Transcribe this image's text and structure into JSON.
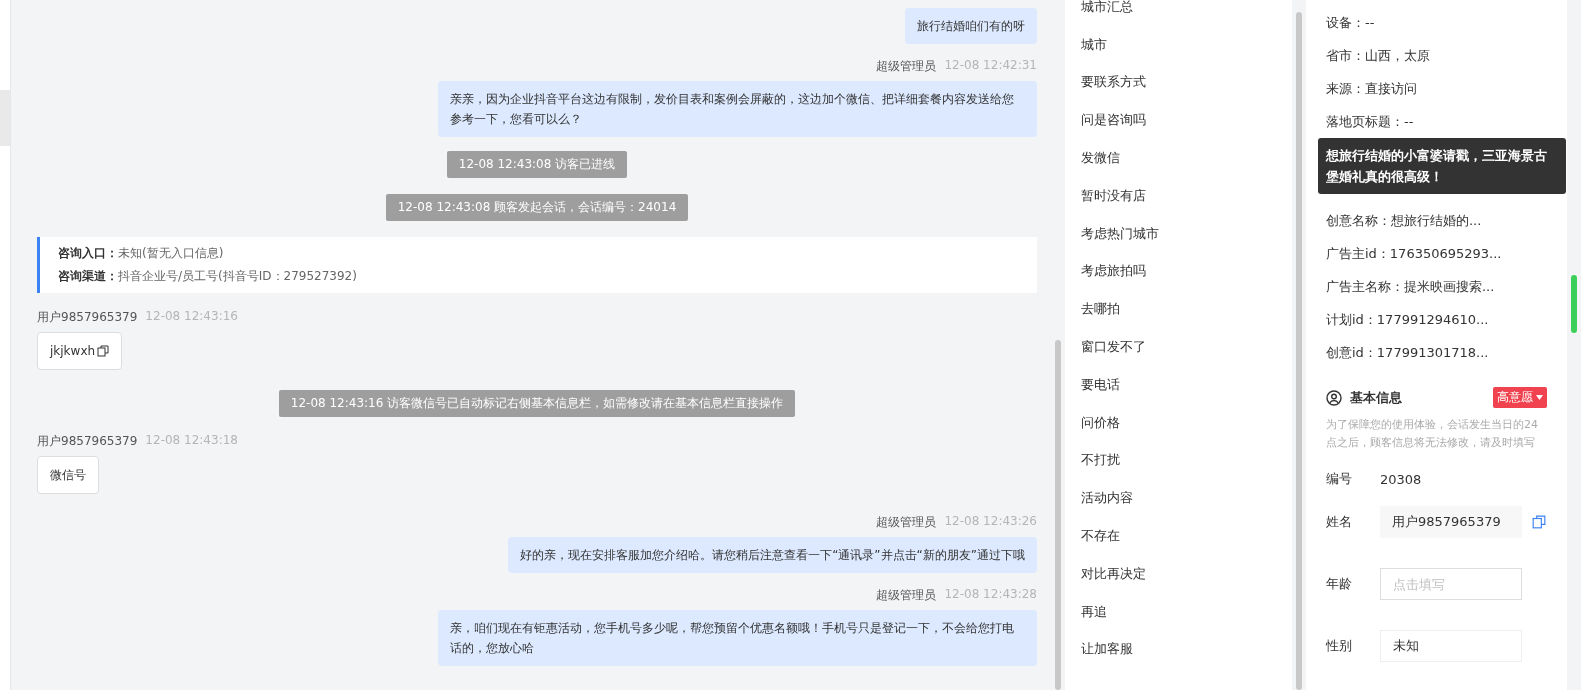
{
  "chat": {
    "messages": [
      {
        "kind": "agent",
        "text": "旅行结婚咱们有的呀"
      },
      {
        "kind": "agent",
        "sender": "超级管理员",
        "time": "12-08 12:42:31",
        "text": "亲亲，因为企业抖音平台这边有限制，发价目表和案例会屏蔽的，这边加个微信、把详细套餐内容发送给您参考一下，您看可以么？"
      },
      {
        "kind": "system",
        "text": "12-08 12:43:08 访客已进线"
      },
      {
        "kind": "system",
        "text": "12-08 12:43:08 顾客发起会话，会话编号：24014"
      },
      {
        "kind": "info",
        "entries": [
          {
            "label": "咨询入口：",
            "value": "未知(暂无入口信息)"
          },
          {
            "label": "咨询渠道：",
            "value": "抖音企业号/员工号(抖音号ID：279527392)"
          }
        ]
      },
      {
        "kind": "visitor",
        "sender": "用户9857965379",
        "time": "12-08 12:43:16",
        "text": "jkjkwxh",
        "copyable": true
      },
      {
        "kind": "system",
        "text": "12-08 12:43:16 访客微信号已自动标记右侧基本信息栏，如需修改请在基本信息栏直接操作"
      },
      {
        "kind": "visitor",
        "sender": "用户9857965379",
        "time": "12-08 12:43:18",
        "text": "微信号",
        "copyable": false
      },
      {
        "kind": "agent",
        "sender": "超级管理员",
        "time": "12-08 12:43:26",
        "text": "好的亲，现在安排客服加您介绍哈。请您稍后注意查看一下“通讯录”并点击“新的朋友”通过下哦"
      },
      {
        "kind": "agent",
        "sender": "超级管理员",
        "time": "12-08 12:43:28",
        "text": "亲，咱们现在有钜惠活动，您手机号多少呢，帮您预留个优惠名额哦！手机号只是登记一下，不会给您打电话的，您放心哈"
      }
    ]
  },
  "quick_replies": [
    "城市汇总",
    "城市",
    "要联系方式",
    "问是咨询吗",
    "发微信",
    "暂时没有店",
    "考虑热门城市",
    "考虑旅拍吗",
    "去哪拍",
    "窗口发不了",
    "要电话",
    "问价格",
    "不打扰",
    "活动内容",
    "不存在",
    "对比再决定",
    "再追",
    "让加客服"
  ],
  "visit_info": {
    "rows_above": [
      "设备：--",
      "省市：山西，太原",
      "来源：直接访问",
      "落地页标题：--"
    ],
    "tooltip": "想旅行结婚的小富婆请戳，三亚海景古堡婚礼真的很高级！",
    "rows_below": [
      "创意名称：想旅行结婚的...",
      "广告主id：176350695293...",
      "广告主名称：提米映画搜索...",
      "计划id：177991294610...",
      "创意id：177991301718..."
    ]
  },
  "basic_info": {
    "title": "基本信息",
    "intent_tag": "高意愿",
    "notice": "为了保障您的使用体验，会话发生当日的24点之后，顾客信息将无法修改，请及时填写",
    "fields": [
      {
        "kind": "text",
        "label": "编号",
        "value": "20308"
      },
      {
        "kind": "copy",
        "label": "姓名",
        "value": "用户9857965379"
      },
      {
        "kind": "input",
        "label": "年龄",
        "placeholder": "点击填写"
      },
      {
        "kind": "select",
        "label": "性别",
        "value": "未知"
      }
    ]
  }
}
